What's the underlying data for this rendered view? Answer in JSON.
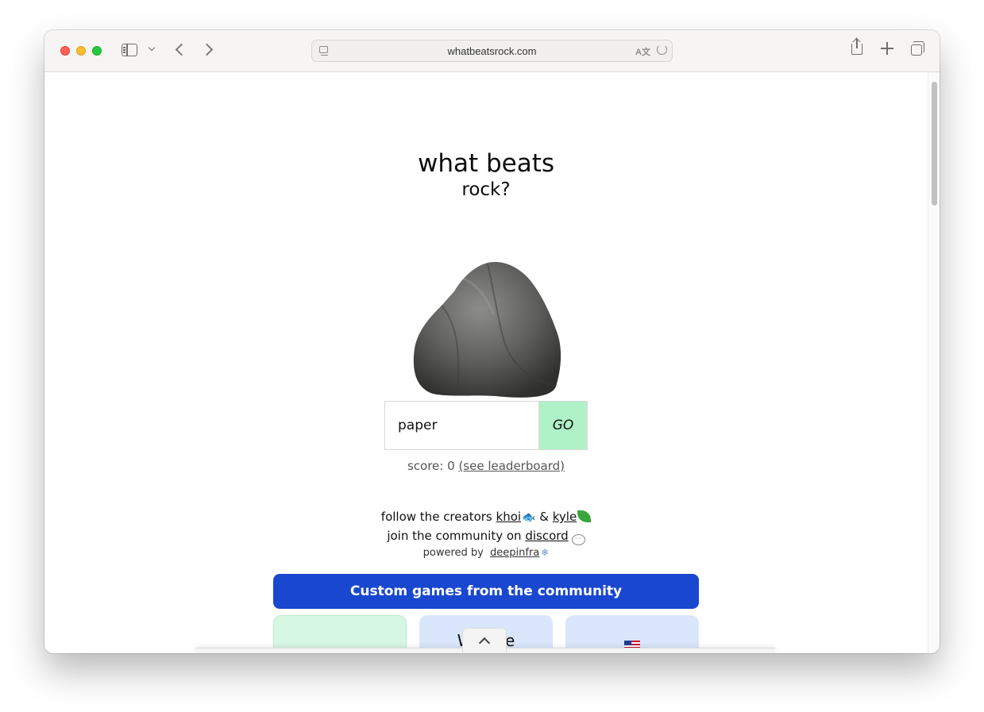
{
  "browser": {
    "url": "whatbeatsrock.com",
    "translate_glyph": "A文"
  },
  "game": {
    "title_line1": "what beats",
    "title_line2": "rock?",
    "input_value": "paper",
    "go_label": "GO",
    "score_text": "score: 0",
    "leaderboard_link": "(see leaderboard)"
  },
  "credits": {
    "follow_text": "follow the creators",
    "creator1": "khoi",
    "separator": "&",
    "creator2": "kyle",
    "join_text": "join the community on",
    "discord_link": "discord",
    "powered_text": "powered by",
    "powered_link": "deepinfra"
  },
  "community": {
    "banner": "Custom games from the community",
    "cards": [
      {
        "text": ""
      },
      {
        "text": "WB     the"
      },
      {
        "text": ""
      }
    ]
  },
  "colors": {
    "go_button": "#b0f2c7",
    "banner": "#1947cf",
    "card_green": "#d6f7e2",
    "card_blue": "#d9e6fb"
  }
}
